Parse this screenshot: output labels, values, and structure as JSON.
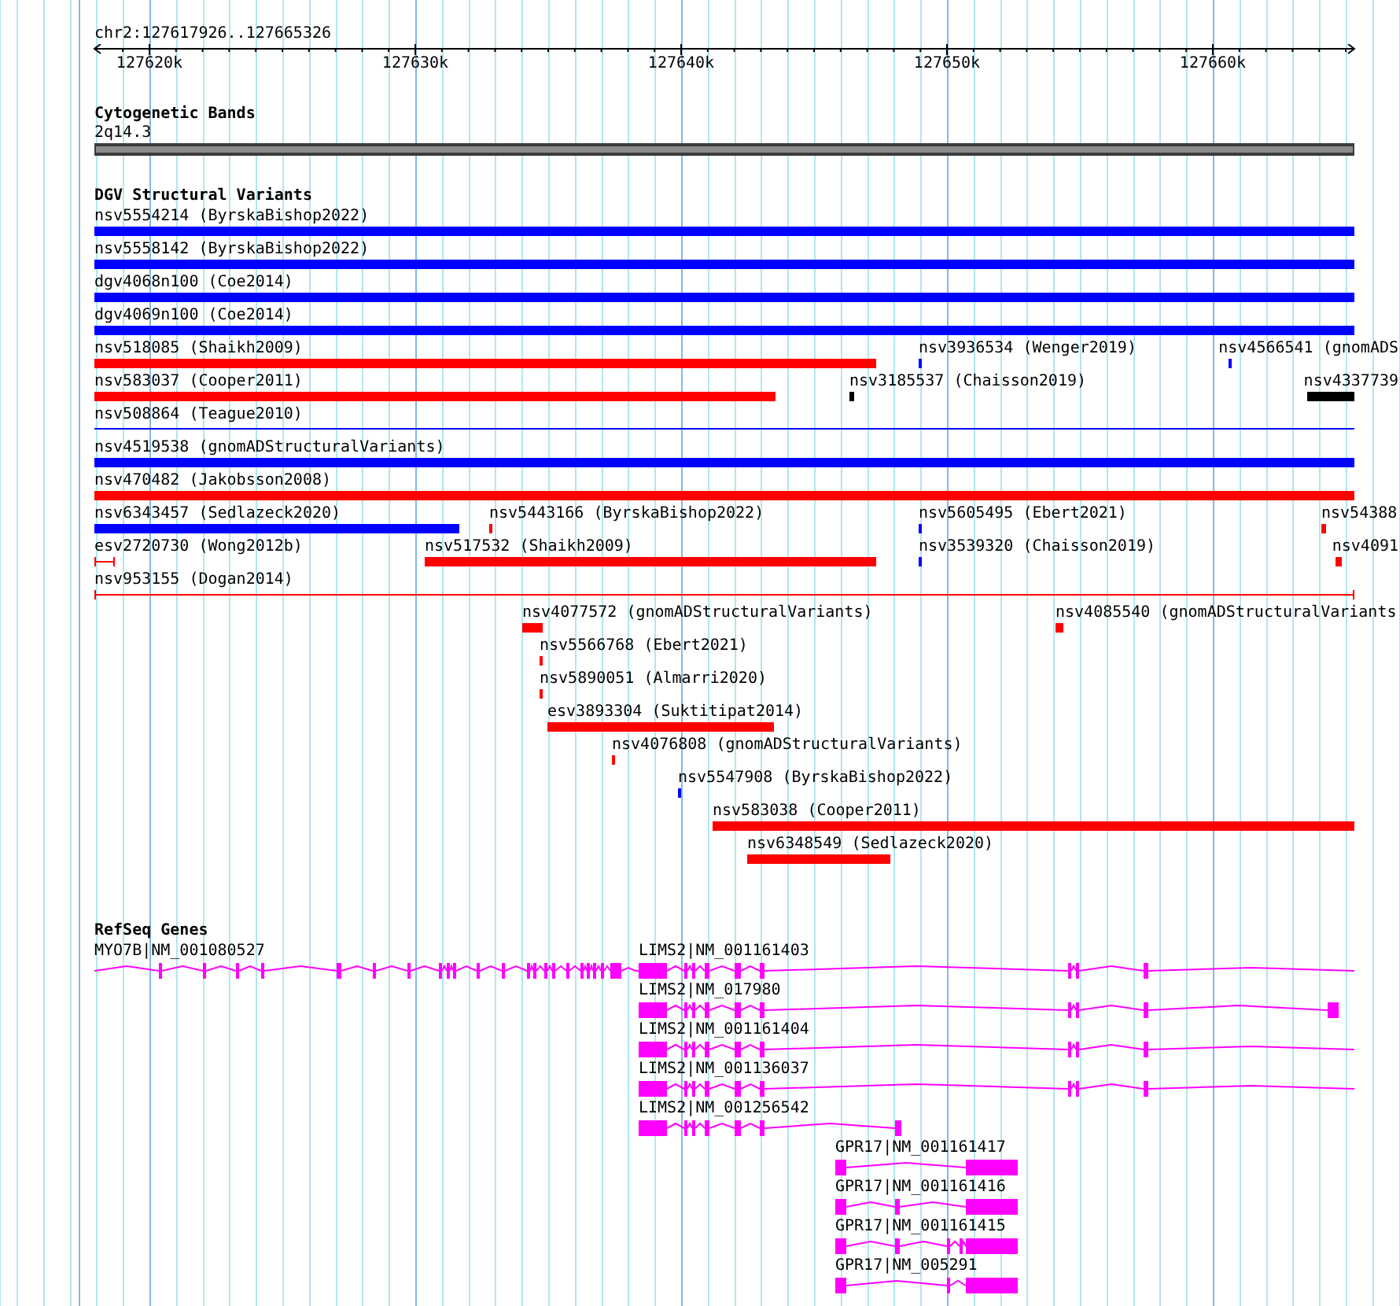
{
  "ruler": {
    "location": "chr2:127617926..127665326",
    "ticks": [
      "127620k",
      "127630k",
      "127640k",
      "127650k",
      "127660k"
    ]
  },
  "bands": {
    "title": "Cytogenetic Bands",
    "label": "2q14.3"
  },
  "variants": {
    "title": "DGV Structural Variants",
    "rows": [
      [
        {
          "label": "nsv5554214 (ByrskaBishop2022)",
          "color": "#0000ff"
        }
      ],
      [
        {
          "label": "nsv5558142 (ByrskaBishop2022)",
          "color": "#0000ff"
        }
      ],
      [
        {
          "label": "dgv4068n100 (Coe2014)",
          "color": "#0000ff"
        }
      ],
      [
        {
          "label": "dgv4069n100 (Coe2014)",
          "color": "#0000ff"
        }
      ],
      [
        {
          "label": "nsv518085 (Shaikh2009)",
          "color": "#ff0000"
        },
        {
          "label": "nsv3936534 (Wenger2019)",
          "color": "#0000ff"
        },
        {
          "label": "nsv4566541 (gnomADS",
          "color": "#0000ff"
        }
      ],
      [
        {
          "label": "nsv583037 (Cooper2011)",
          "color": "#ff0000"
        },
        {
          "label": "nsv3185537 (Chaisson2019)",
          "color": "#000000"
        },
        {
          "label": "nsv4337739",
          "color": "#000000"
        }
      ],
      [
        {
          "label": "nsv508864 (Teague2010)",
          "color": "#0000ff"
        }
      ],
      [
        {
          "label": "nsv4519538 (gnomADStructuralVariants)",
          "color": "#0000ff"
        }
      ],
      [
        {
          "label": "nsv470482 (Jakobsson2008)",
          "color": "#ff0000"
        }
      ],
      [
        {
          "label": "nsv6343457 (Sedlazeck2020)",
          "color": "#0000ff"
        },
        {
          "label": "nsv5443166 (ByrskaBishop2022)",
          "color": "#ff0000"
        },
        {
          "label": "nsv5605495 (Ebert2021)",
          "color": "#0000ff"
        },
        {
          "label": "nsv54388",
          "color": "#ff0000"
        }
      ],
      [
        {
          "label": "esv2720730 (Wong2012b)",
          "color": "#ff0000"
        },
        {
          "label": "nsv517532 (Shaikh2009)",
          "color": "#ff0000"
        },
        {
          "label": "nsv3539320 (Chaisson2019)",
          "color": "#0000ff"
        },
        {
          "label": "nsv4091",
          "color": "#ff0000"
        }
      ],
      [
        {
          "label": "nsv953155 (Dogan2014)",
          "color": "#ff0000"
        }
      ],
      [
        {
          "label": "nsv4077572 (gnomADStructuralVariants)",
          "color": "#ff0000"
        },
        {
          "label": "nsv4085540 (gnomADStructuralVariants",
          "color": "#ff0000"
        }
      ],
      [
        {
          "label": "nsv5566768 (Ebert2021)",
          "color": "#ff0000"
        }
      ],
      [
        {
          "label": "nsv5890051 (Almarri2020)",
          "color": "#ff0000"
        }
      ],
      [
        {
          "label": "esv3893304 (Suktitipat2014)",
          "color": "#ff0000"
        }
      ],
      [
        {
          "label": "nsv4076808 (gnomADStructuralVariants)",
          "color": "#ff0000"
        }
      ],
      [
        {
          "label": "nsv5547908 (ByrskaBishop2022)",
          "color": "#0000ff"
        }
      ],
      [
        {
          "label": "nsv583038 (Cooper2011)",
          "color": "#ff0000"
        }
      ],
      [
        {
          "label": "nsv6348549 (Sedlazeck2020)",
          "color": "#ff0000"
        }
      ]
    ]
  },
  "genes": {
    "title": "RefSeq Genes",
    "rows": [
      [
        {
          "label": "MYO7B|NM_001080527"
        },
        {
          "label": "LIMS2|NM_001161403"
        }
      ],
      [
        {
          "label": "LIMS2|NM_017980"
        }
      ],
      [
        {
          "label": "LIMS2|NM_001161404"
        }
      ],
      [
        {
          "label": "LIMS2|NM_001136037"
        }
      ],
      [
        {
          "label": "LIMS2|NM_001256542"
        }
      ],
      [
        {
          "label": "GPR17|NM_001161417"
        }
      ],
      [
        {
          "label": "GPR17|NM_001161416"
        }
      ],
      [
        {
          "label": "GPR17|NM_001161415"
        }
      ],
      [
        {
          "label": "GPR17|NM_005291"
        }
      ]
    ]
  }
}
